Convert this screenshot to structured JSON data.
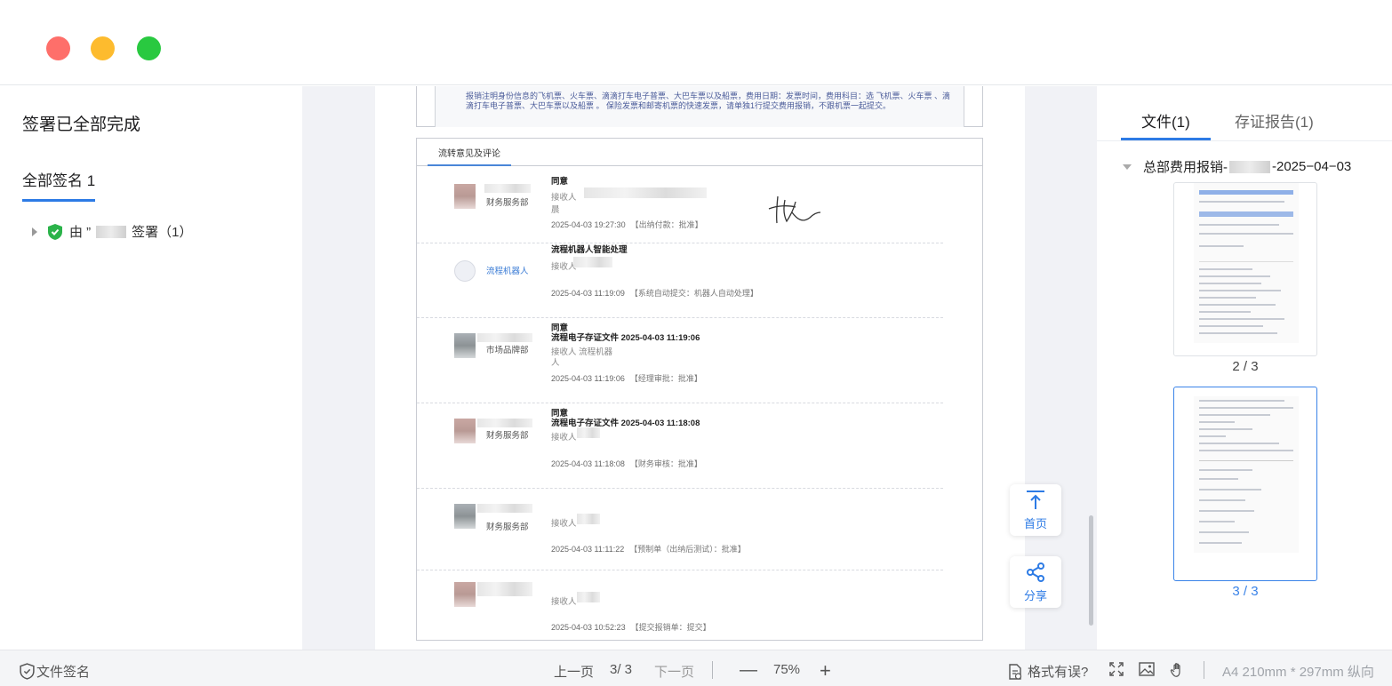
{
  "window": {
    "controls": [
      "close",
      "minimize",
      "maximize"
    ]
  },
  "left_panel": {
    "status": "签署已全部完成",
    "tab_label": "全部签名 1",
    "signer_prefix": "由 ”",
    "signer_suffix": "签署（1）"
  },
  "document": {
    "top_text": "报销注明身份信息的飞机票、火车票、滴滴打车电子普票、大巴车票以及船票，费用日期：发票时间，费用科目：选 飞机票、火车票 、滴滴打车电子普票、大巴车票以及船票 。 保险发票和邮寄机票的快速发票，请单独1行提交费用报销，不跟机票一起提交。",
    "comment_tab": "流转意见及评论",
    "entries": [
      {
        "dept": "财务服务部",
        "lines": [
          "同意"
        ],
        "receiver_label": "接收人",
        "extra": "晨",
        "date": "2025-04-03  19:27:30",
        "action": "【出纳付款：批准】"
      },
      {
        "dept": "流程机器人",
        "lines": [
          "流程机器人智能处理"
        ],
        "receiver_label": "接收人",
        "date": "2025-04-03  11:19:09",
        "action": "【系统自动提交：机器人自动处理】"
      },
      {
        "dept": "市场品牌部",
        "lines": [
          "同意",
          "流程电子存证文件 2025-04-03 11:19:06"
        ],
        "receiver_label": "接收人  流程机器",
        "extra": "人",
        "date": "2025-04-03  11:19:06",
        "action": "【经理审批：批准】"
      },
      {
        "dept": "财务服务部",
        "lines": [
          "同意",
          "流程电子存证文件 2025-04-03 11:18:08"
        ],
        "receiver_label": "接收人",
        "date": "2025-04-03  11:18:08",
        "action": "【财务审核：批准】"
      },
      {
        "dept": "财务服务部",
        "lines": [],
        "receiver_label": "接收人",
        "date": "2025-04-03  11:11:22",
        "action": "【预制单（出纳后测试）：批准】"
      },
      {
        "dept": "",
        "lines": [],
        "receiver_label": "接收人",
        "date": "2025-04-03  10:52:23",
        "action": "【提交报销单：提交】"
      }
    ]
  },
  "fabs": {
    "top_label": "首页",
    "share_label": "分享"
  },
  "right_panel": {
    "tab_files": "文件(1)",
    "tab_report": "存证报告(1)",
    "doc_title_prefix": "总部费用报销-",
    "doc_title_suffix": "-2025−04−03",
    "pages": [
      {
        "label": "2 / 3",
        "selected": false
      },
      {
        "label": "3 / 3",
        "selected": true
      }
    ]
  },
  "toolbar": {
    "file_sign": "文件签名",
    "prev": "上一页",
    "page": "3/ 3",
    "next": "下一页",
    "zoom": "75%",
    "format_error": "格式有误?",
    "paper": "A4 210mm * 297mm 纵向"
  },
  "colors": {
    "accent": "#2d7be5",
    "success": "#2bb34a"
  }
}
